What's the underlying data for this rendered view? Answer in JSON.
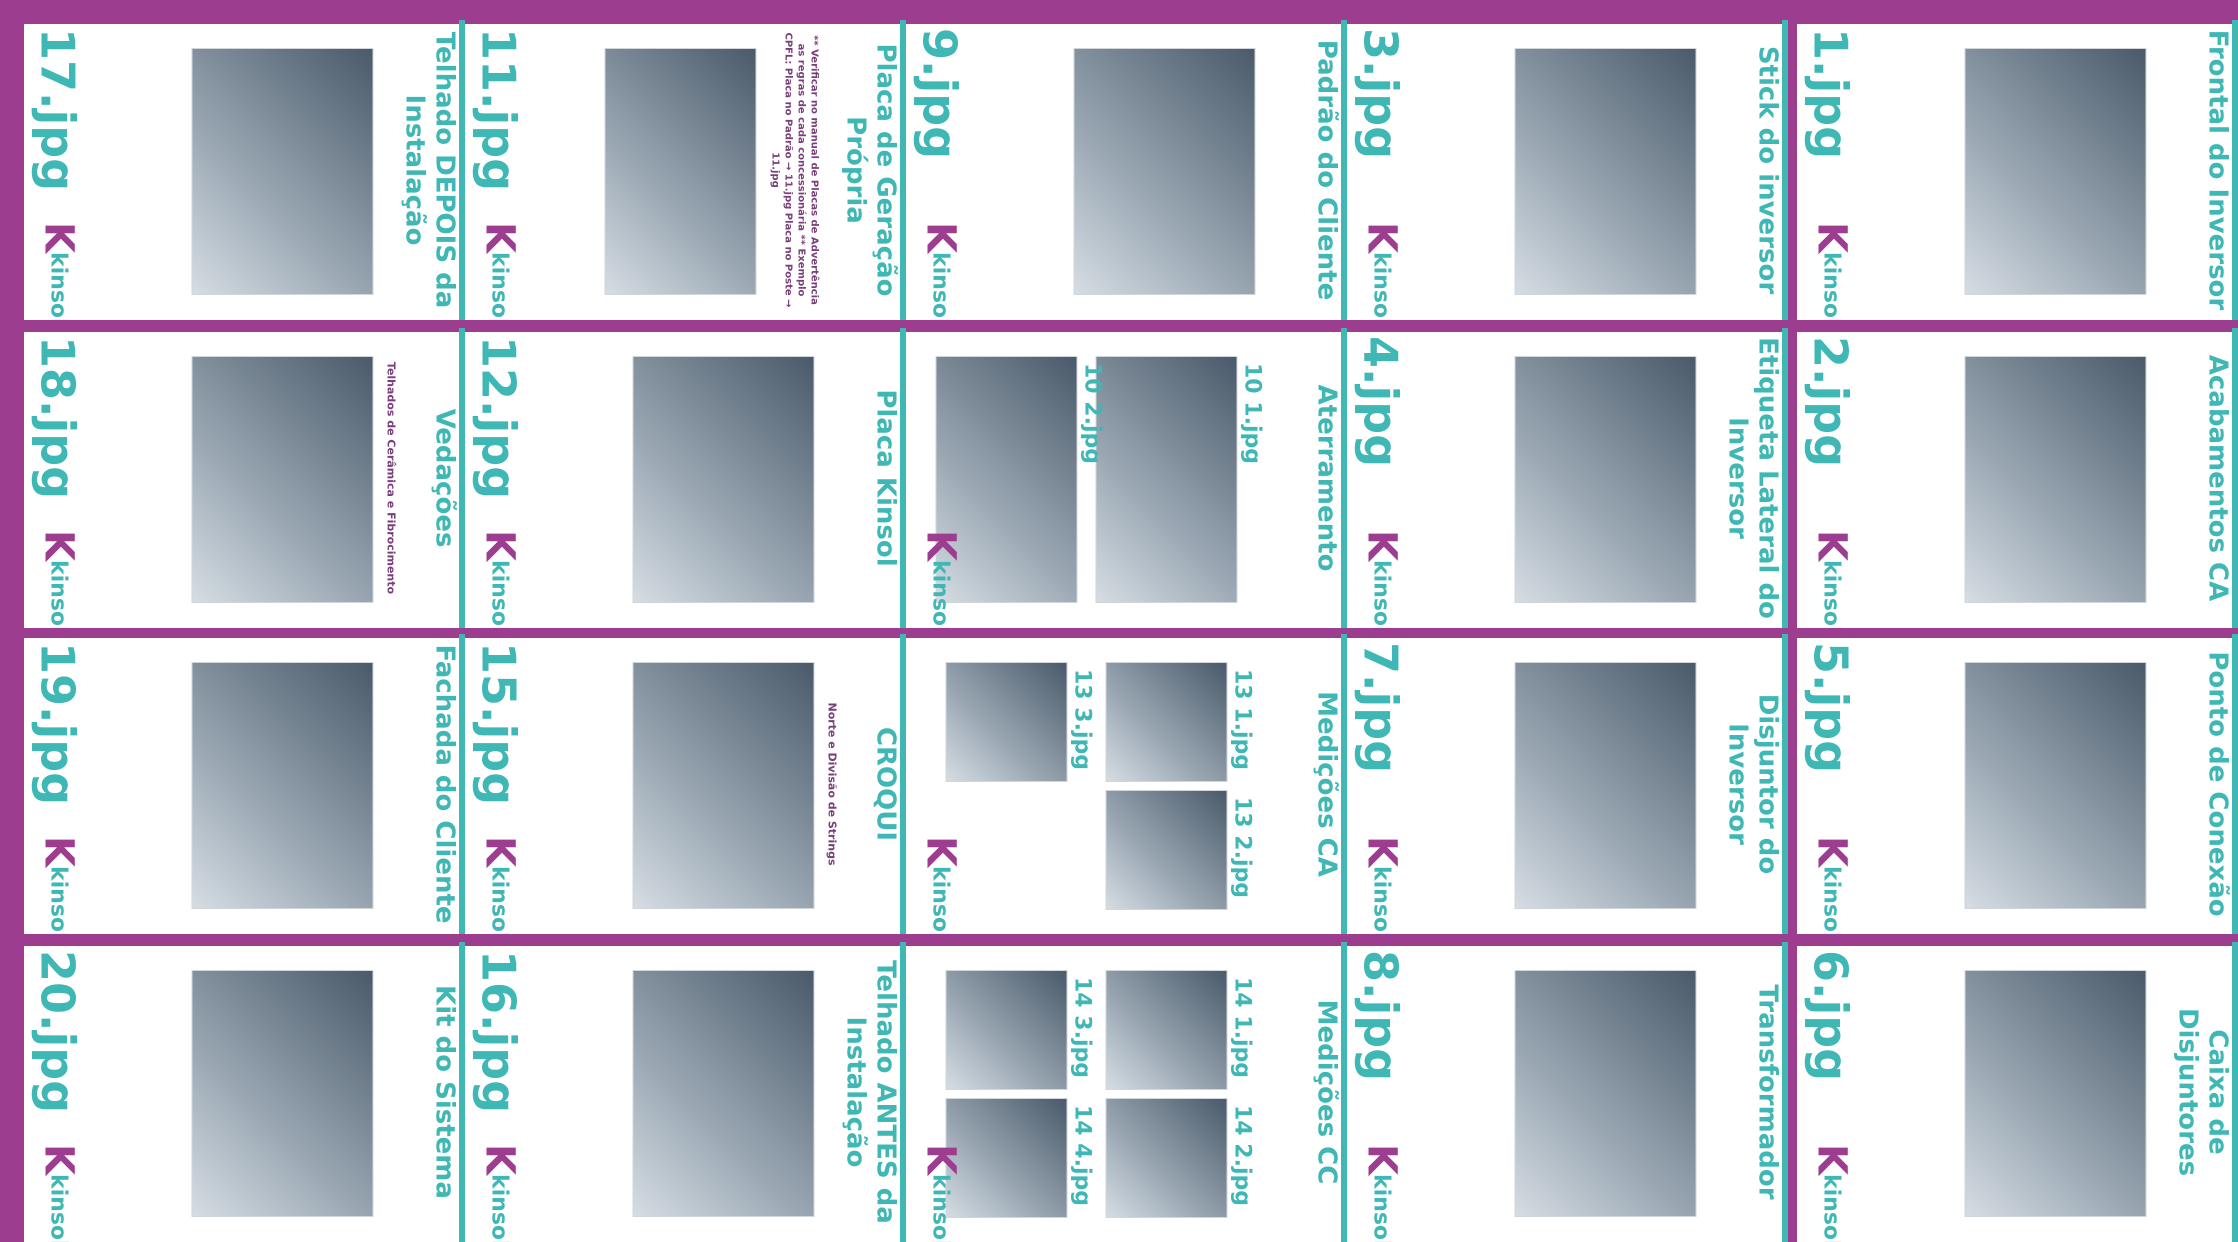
{
  "cards": [
    {
      "id": "c1",
      "title": "Frontal do Inversor",
      "code": "1.jpg",
      "subtitle": ""
    },
    {
      "id": "c2",
      "title": "Acabamentos CA",
      "code": "2.jpg",
      "subtitle": ""
    },
    {
      "id": "c3",
      "title": "Ponto de Conexão",
      "code": "5.jpg",
      "subtitle": ""
    },
    {
      "id": "c4",
      "title": "Caixa de Disjuntores",
      "code": "6.jpg",
      "subtitle": ""
    },
    {
      "id": "c5",
      "title": "Stick do inversor",
      "code": "3.jpg",
      "subtitle": ""
    },
    {
      "id": "c6",
      "title": "Etiqueta Lateral do Inversor",
      "code": "4.jpg",
      "subtitle": ""
    },
    {
      "id": "c7",
      "title": "Disjuntor do Inversor",
      "code": "7.jpg",
      "subtitle": ""
    },
    {
      "id": "c8",
      "title": "Transformador",
      "code": "8.jpg",
      "subtitle": ""
    },
    {
      "id": "c9",
      "title": "Padrão do Cliente",
      "code": "9.jpg",
      "subtitle": ""
    },
    {
      "id": "c10",
      "title": "Aterramento",
      "code": "",
      "subtitle": "",
      "photo_labels": [
        "10 1.jpg",
        "10 2.jpg"
      ]
    },
    {
      "id": "c11",
      "title": "Medições CA",
      "code": "",
      "subtitle": "",
      "photo_labels": [
        "13 1.jpg",
        "13 2.jpg",
        "13 3.jpg"
      ]
    },
    {
      "id": "c12",
      "title": "Medições CC",
      "code": "",
      "subtitle": "",
      "photo_labels": [
        "14 1.jpg",
        "14 2.jpg",
        "14 3.jpg",
        "14 4.jpg"
      ]
    },
    {
      "id": "c13",
      "title": "Placa de Geração Própria",
      "code": "11.jpg",
      "subtitle": "",
      "note": "** Verificar no manual de Placas de Advertência as regras de cada concessionária ** Exemplo CPFL: Placa no Padrão → 11.jpg Placa no Poste → 11.jpg"
    },
    {
      "id": "c14",
      "title": "Placa Kinsol",
      "code": "12.jpg",
      "subtitle": ""
    },
    {
      "id": "c15",
      "title": "CROQUI",
      "code": "15.jpg",
      "subtitle": "Norte e Divisão de Strings"
    },
    {
      "id": "c16",
      "title": "Telhado ANTES da Instalação",
      "code": "16.jpg",
      "subtitle": ""
    },
    {
      "id": "c17",
      "title": "Telhado DEPOIS da Instalação",
      "code": "17.jpg",
      "subtitle": ""
    },
    {
      "id": "c18",
      "title": "Vedações",
      "code": "18.jpg",
      "subtitle": "Telhados de Cerâmica e Fibrocimento"
    },
    {
      "id": "c19",
      "title": "Fachada do Cliente",
      "code": "19.jpg",
      "subtitle": ""
    },
    {
      "id": "c20",
      "title": "Kit do Sistema",
      "code": "20.jpg",
      "subtitle": ""
    }
  ],
  "brand": {
    "logo_text": "kinsol",
    "logo_mark": "K",
    "accent": "#3fb7b4",
    "magenta": "#9c3d8f"
  }
}
